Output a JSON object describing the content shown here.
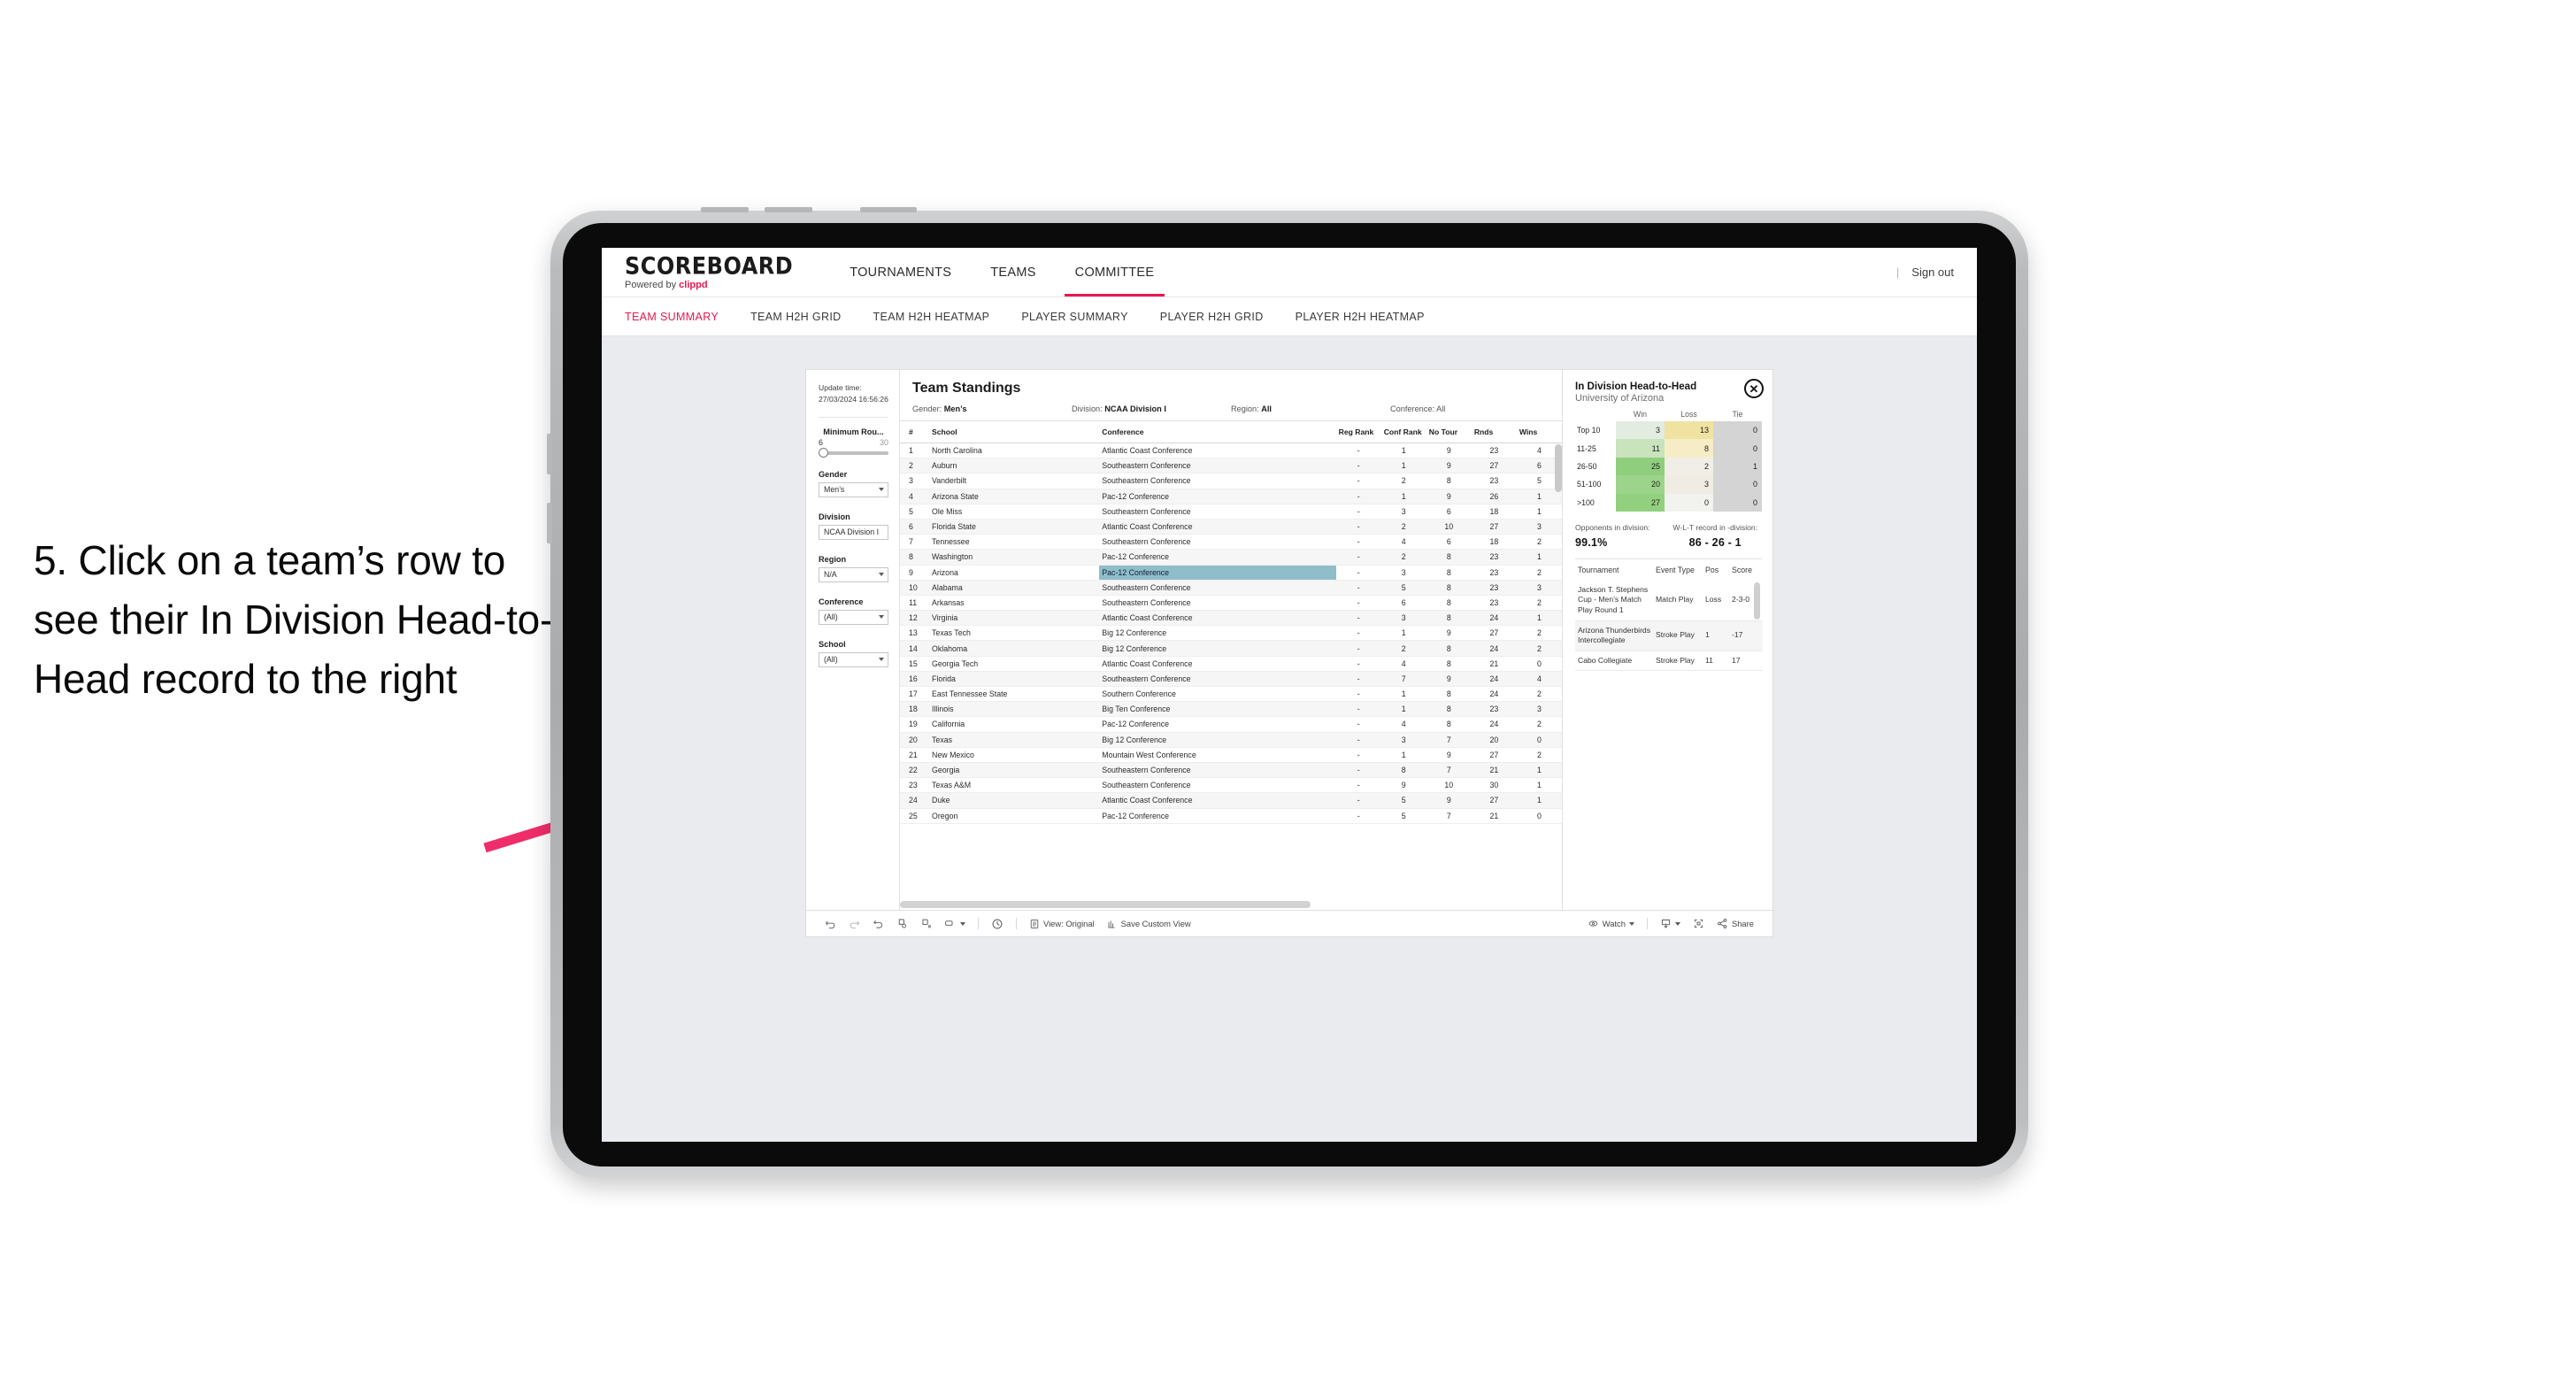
{
  "annotation": {
    "text": "5. Click on a team’s row to see their In Division Head-to-Head record to the right",
    "arrow_color": "#ef2d6a"
  },
  "app": {
    "logo": {
      "word": "SCOREBOARD",
      "powered_prefix": "Powered by ",
      "powered_brand": "clippd"
    },
    "topnav": [
      {
        "label": "TOURNAMENTS",
        "active": false
      },
      {
        "label": "TEAMS",
        "active": false
      },
      {
        "label": "COMMITTEE",
        "active": true
      }
    ],
    "signout": {
      "divider": "|",
      "label": "Sign out"
    },
    "subnav": [
      {
        "label": "TEAM SUMMARY",
        "active": true
      },
      {
        "label": "TEAM H2H GRID",
        "active": false
      },
      {
        "label": "TEAM H2H HEATMAP",
        "active": false
      },
      {
        "label": "PLAYER SUMMARY",
        "active": false
      },
      {
        "label": "PLAYER H2H GRID",
        "active": false
      },
      {
        "label": "PLAYER H2H HEATMAP",
        "active": false
      }
    ],
    "accent": "#e8174f"
  },
  "filters": {
    "update_time_label": "Update time:",
    "update_time_value": "27/03/2024 16:56:26",
    "slider": {
      "title": "Minimum Rou...",
      "min": "6",
      "max": "30"
    },
    "selects": [
      {
        "label": "Gender",
        "value": "Men’s"
      },
      {
        "label": "Division",
        "value": "NCAA Division I"
      },
      {
        "label": "Region",
        "value": "N/A"
      },
      {
        "label": "Conference",
        "value": "(All)"
      },
      {
        "label": "School",
        "value": "(All)"
      }
    ]
  },
  "standings": {
    "title": "Team Standings",
    "meta": [
      {
        "label": "Gender:",
        "value": "Men’s"
      },
      {
        "label": "Division:",
        "value": "NCAA Division I"
      },
      {
        "label": "Region:",
        "value": "All"
      },
      {
        "label": "Conference:",
        "value": "All"
      }
    ],
    "columns": [
      "#",
      "School",
      "Conference",
      "Reg Rank",
      "Conf Rank",
      "No Tour",
      "Rnds",
      "Wins"
    ],
    "highlight_color": "#8fbdca",
    "highlighted_row_index": 8,
    "rows": [
      {
        "num": "1",
        "school": "North Carolina",
        "conference": "Atlantic Coast Conference",
        "reg": "-",
        "conf": "1",
        "notour": "9",
        "rnds": "23",
        "wins": "4"
      },
      {
        "num": "2",
        "school": "Auburn",
        "conference": "Southeastern Conference",
        "reg": "-",
        "conf": "1",
        "notour": "9",
        "rnds": "27",
        "wins": "6"
      },
      {
        "num": "3",
        "school": "Vanderbilt",
        "conference": "Southeastern Conference",
        "reg": "-",
        "conf": "2",
        "notour": "8",
        "rnds": "23",
        "wins": "5"
      },
      {
        "num": "4",
        "school": "Arizona State",
        "conference": "Pac-12 Conference",
        "reg": "-",
        "conf": "1",
        "notour": "9",
        "rnds": "26",
        "wins": "1"
      },
      {
        "num": "5",
        "school": "Ole Miss",
        "conference": "Southeastern Conference",
        "reg": "-",
        "conf": "3",
        "notour": "6",
        "rnds": "18",
        "wins": "1"
      },
      {
        "num": "6",
        "school": "Florida State",
        "conference": "Atlantic Coast Conference",
        "reg": "-",
        "conf": "2",
        "notour": "10",
        "rnds": "27",
        "wins": "3"
      },
      {
        "num": "7",
        "school": "Tennessee",
        "conference": "Southeastern Conference",
        "reg": "-",
        "conf": "4",
        "notour": "6",
        "rnds": "18",
        "wins": "2"
      },
      {
        "num": "8",
        "school": "Washington",
        "conference": "Pac-12 Conference",
        "reg": "-",
        "conf": "2",
        "notour": "8",
        "rnds": "23",
        "wins": "1"
      },
      {
        "num": "9",
        "school": "Arizona",
        "conference": "Pac-12 Conference",
        "reg": "-",
        "conf": "3",
        "notour": "8",
        "rnds": "23",
        "wins": "2"
      },
      {
        "num": "10",
        "school": "Alabama",
        "conference": "Southeastern Conference",
        "reg": "-",
        "conf": "5",
        "notour": "8",
        "rnds": "23",
        "wins": "3"
      },
      {
        "num": "11",
        "school": "Arkansas",
        "conference": "Southeastern Conference",
        "reg": "-",
        "conf": "6",
        "notour": "8",
        "rnds": "23",
        "wins": "2"
      },
      {
        "num": "12",
        "school": "Virginia",
        "conference": "Atlantic Coast Conference",
        "reg": "-",
        "conf": "3",
        "notour": "8",
        "rnds": "24",
        "wins": "1"
      },
      {
        "num": "13",
        "school": "Texas Tech",
        "conference": "Big 12 Conference",
        "reg": "-",
        "conf": "1",
        "notour": "9",
        "rnds": "27",
        "wins": "2"
      },
      {
        "num": "14",
        "school": "Oklahoma",
        "conference": "Big 12 Conference",
        "reg": "-",
        "conf": "2",
        "notour": "8",
        "rnds": "24",
        "wins": "2"
      },
      {
        "num": "15",
        "school": "Georgia Tech",
        "conference": "Atlantic Coast Conference",
        "reg": "-",
        "conf": "4",
        "notour": "8",
        "rnds": "21",
        "wins": "0"
      },
      {
        "num": "16",
        "school": "Florida",
        "conference": "Southeastern Conference",
        "reg": "-",
        "conf": "7",
        "notour": "9",
        "rnds": "24",
        "wins": "4"
      },
      {
        "num": "17",
        "school": "East Tennessee State",
        "conference": "Southern Conference",
        "reg": "-",
        "conf": "1",
        "notour": "8",
        "rnds": "24",
        "wins": "2"
      },
      {
        "num": "18",
        "school": "Illinois",
        "conference": "Big Ten Conference",
        "reg": "-",
        "conf": "1",
        "notour": "8",
        "rnds": "23",
        "wins": "3"
      },
      {
        "num": "19",
        "school": "California",
        "conference": "Pac-12 Conference",
        "reg": "-",
        "conf": "4",
        "notour": "8",
        "rnds": "24",
        "wins": "2"
      },
      {
        "num": "20",
        "school": "Texas",
        "conference": "Big 12 Conference",
        "reg": "-",
        "conf": "3",
        "notour": "7",
        "rnds": "20",
        "wins": "0"
      },
      {
        "num": "21",
        "school": "New Mexico",
        "conference": "Mountain West Conference",
        "reg": "-",
        "conf": "1",
        "notour": "9",
        "rnds": "27",
        "wins": "2"
      },
      {
        "num": "22",
        "school": "Georgia",
        "conference": "Southeastern Conference",
        "reg": "-",
        "conf": "8",
        "notour": "7",
        "rnds": "21",
        "wins": "1"
      },
      {
        "num": "23",
        "school": "Texas A&M",
        "conference": "Southeastern Conference",
        "reg": "-",
        "conf": "9",
        "notour": "10",
        "rnds": "30",
        "wins": "1"
      },
      {
        "num": "24",
        "school": "Duke",
        "conference": "Atlantic Coast Conference",
        "reg": "-",
        "conf": "5",
        "notour": "9",
        "rnds": "27",
        "wins": "1"
      },
      {
        "num": "25",
        "school": "Oregon",
        "conference": "Pac-12 Conference",
        "reg": "-",
        "conf": "5",
        "notour": "7",
        "rnds": "21",
        "wins": "0"
      }
    ]
  },
  "h2h": {
    "title": "In Division Head-to-Head",
    "subtitle": "University of Arizona",
    "close_icon": "✕",
    "columns": [
      "",
      "Win",
      "Loss",
      "Tie"
    ],
    "chart_data": {
      "type": "heatmap",
      "title": "In Division Head-to-Head",
      "subtitle": "University of Arizona",
      "xlabel": "",
      "ylabel": "",
      "categories": [
        "Win",
        "Loss",
        "Tie"
      ],
      "row_labels": [
        "Top 10",
        "11-25",
        "26-50",
        "51-100",
        ">100"
      ],
      "values": [
        [
          3,
          13,
          0
        ],
        [
          11,
          8,
          0
        ],
        [
          25,
          2,
          1
        ],
        [
          20,
          3,
          0
        ],
        [
          27,
          0,
          0
        ]
      ],
      "cell_colors": [
        [
          "#e2ece0",
          "#f0e2a0",
          "#d4d4d4"
        ],
        [
          "#c9e3bc",
          "#f6edc6",
          "#d4d4d4"
        ],
        [
          "#8fce7d",
          "#f0eee6",
          "#d4d4d4"
        ],
        [
          "#9bd48a",
          "#f1ece3",
          "#d4d4d4"
        ],
        [
          "#92d07f",
          "#f2f2ee",
          "#d4d4d4"
        ]
      ],
      "legend_position": "none",
      "grid": false
    },
    "rows": [
      {
        "label": "Top 10",
        "win": "3",
        "loss": "13",
        "tie": "0"
      },
      {
        "label": "11-25",
        "win": "11",
        "loss": "8",
        "tie": "0"
      },
      {
        "label": "26-50",
        "win": "25",
        "loss": "2",
        "tie": "1"
      },
      {
        "label": "51-100",
        "win": "20",
        "loss": "3",
        "tie": "0"
      },
      {
        "label": ">100",
        "win": "27",
        "loss": "0",
        "tie": "0"
      }
    ],
    "stats": [
      {
        "label": "Opponents in division:",
        "value": "99.1%"
      },
      {
        "label": "W-L-T record in -division:",
        "value": "86 - 26 - 1"
      }
    ],
    "tournament_columns": [
      "Tournament",
      "Event Type",
      "Pos",
      "Score"
    ],
    "tournaments": [
      {
        "name": "Jackson T. Stephens Cup - Men’s Match Play Round 1",
        "type": "Match Play",
        "pos": "Loss",
        "score": "2-3-0"
      },
      {
        "name": "Arizona Thunderbirds Intercollegiate",
        "type": "Stroke Play",
        "pos": "1",
        "score": "-17"
      },
      {
        "name": "Cabo Collegiate",
        "type": "Stroke Play",
        "pos": "11",
        "score": "17"
      }
    ]
  },
  "toolbar": {
    "view_label": "View: Original",
    "save_label": "Save Custom View",
    "watch_label": "Watch",
    "share_label": "Share"
  }
}
